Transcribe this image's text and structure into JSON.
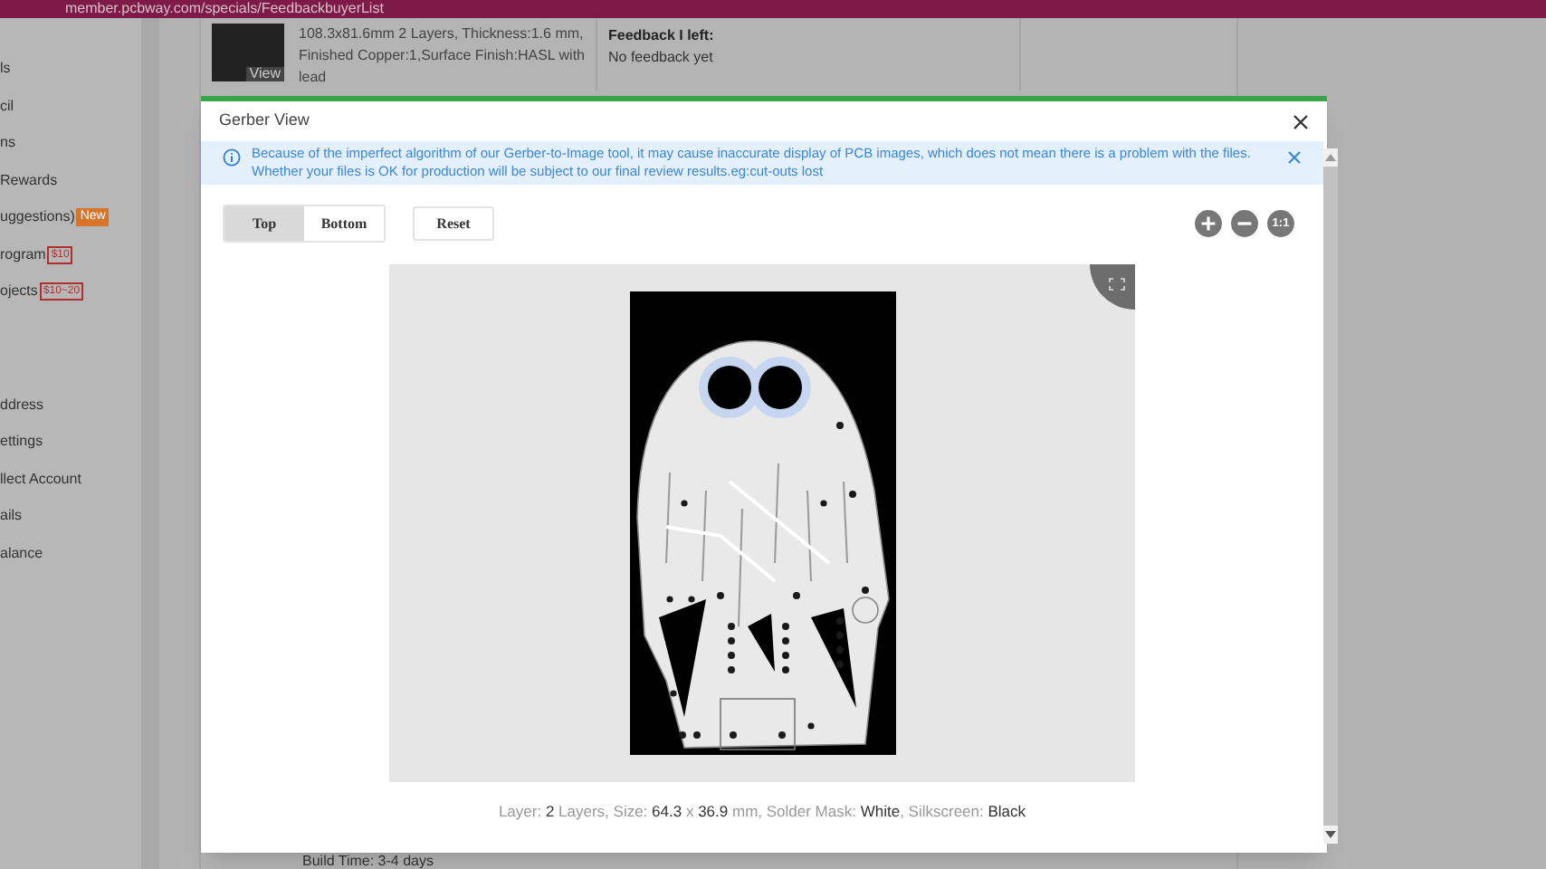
{
  "browser": {
    "url": "member.pcbway.com/specials/FeedbackbuyerList"
  },
  "sidebar": {
    "items": [
      {
        "label": "ls"
      },
      {
        "label": "cil"
      },
      {
        "label": "ns"
      },
      {
        "label": "Rewards"
      },
      {
        "label": "uggestions)",
        "badge": "New"
      },
      {
        "label": "rogram",
        "badge": "$10"
      },
      {
        "label": "ojects",
        "badge": "$10~20"
      },
      {
        "label": "ddress"
      },
      {
        "label": "ettings"
      },
      {
        "label": "llect Account"
      },
      {
        "label": "ails"
      },
      {
        "label": "alance"
      }
    ]
  },
  "order": {
    "thumbnail_label": "View",
    "description": "108.3x81.6mm 2 Layers, Thickness:1.6 mm, Finished Copper:1,Surface Finish:HASL with lead",
    "feedback_title": "Feedback I left:",
    "feedback_value": "No feedback yet",
    "build_time": "Build Time: 3-4 days"
  },
  "dialog": {
    "title": "Gerber View",
    "notice": "Because of the imperfect algorithm of our Gerber-to-Image tool, it may cause inaccurate display of PCB images, which does not mean there is a problem with the files. Whether your files is OK for production will be subject to our final review results.eg:cut-outs lost",
    "tabs": [
      {
        "label": "Top",
        "selected": true
      },
      {
        "label": "Bottom",
        "selected": false
      }
    ],
    "reset": "Reset",
    "fit_label": "1:1",
    "caption": [
      {
        "text": "Layer: ",
        "value": false
      },
      {
        "text": "2",
        "value": true
      },
      {
        "text": " Layers, Size: ",
        "value": false
      },
      {
        "text": "64.3",
        "value": true
      },
      {
        "text": " x ",
        "value": false
      },
      {
        "text": "36.9",
        "value": true
      },
      {
        "text": " mm, Solder Mask: ",
        "value": false
      },
      {
        "text": "White",
        "value": true
      },
      {
        "text": ", Silkscreen: ",
        "value": false
      },
      {
        "text": "Black",
        "value": true
      }
    ]
  }
}
